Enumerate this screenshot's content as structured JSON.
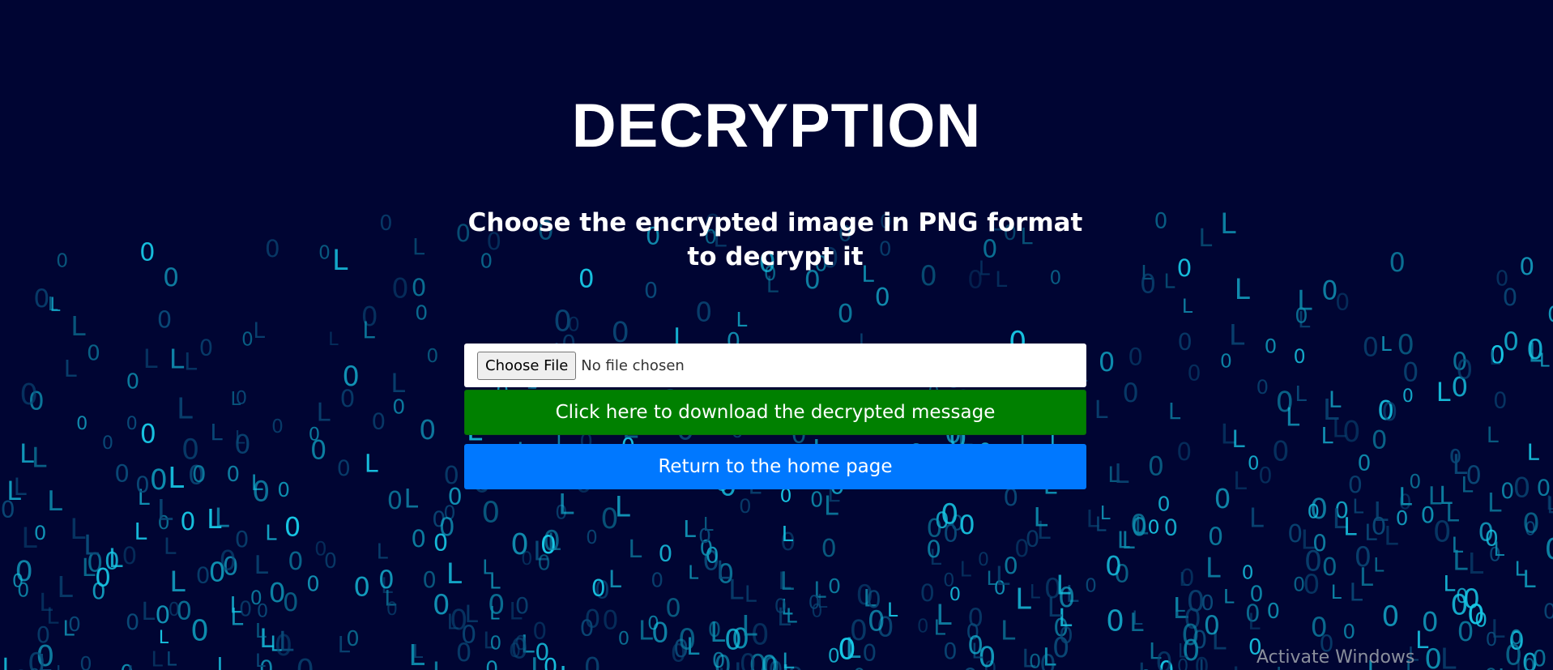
{
  "page": {
    "title": "DECRYPTION",
    "subtitle": "Choose the encrypted image in PNG format to decrypt it"
  },
  "file_input": {
    "button_label": "Choose File",
    "status_text": "No file chosen"
  },
  "buttons": {
    "download_label": "Click here to download the decrypted message",
    "home_label": "Return to the home page"
  },
  "os_overlay": {
    "watermark_text": "Activate Windows"
  },
  "background": {
    "glyphs": [
      "0",
      "L"
    ],
    "colors": {
      "page": "#000533",
      "bright": "#18c8e6",
      "mid": "#0e8fb0",
      "dim": "#0a4a78"
    }
  },
  "colors": {
    "title_text": "#ffffff",
    "download_button": "#008000",
    "home_button": "#0078ff"
  }
}
